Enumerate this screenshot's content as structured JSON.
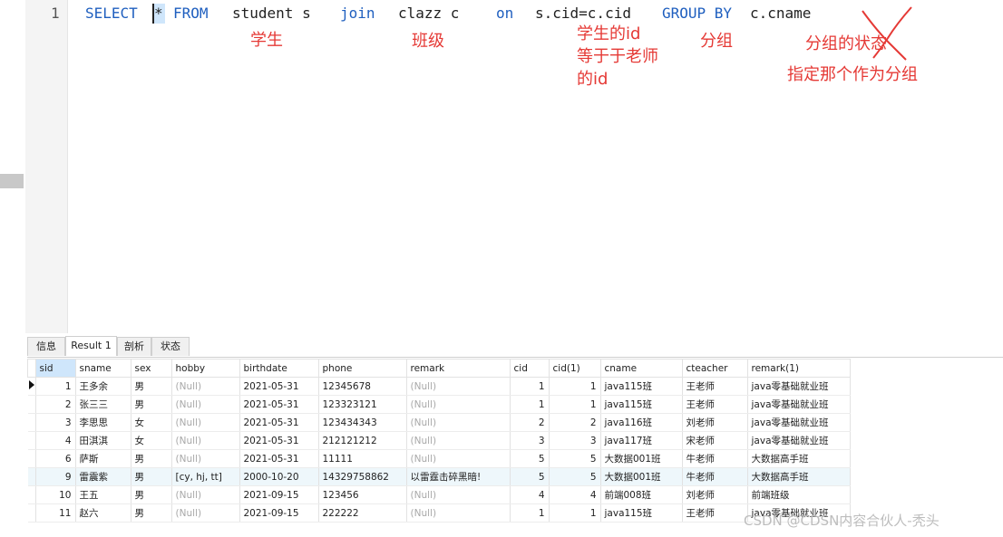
{
  "editor": {
    "line_number": "1",
    "tokens": [
      "SELECT",
      "*",
      "FROM",
      "student s",
      "join",
      "clazz c",
      "on",
      "s.cid=c.cid",
      "GROUP BY",
      "c.cname"
    ],
    "annotations": {
      "student": "学生",
      "clazz": "班级",
      "id_lines": [
        "学生的id",
        "等于于老师",
        "的id"
      ],
      "group": "分组",
      "state": "分组的状态",
      "specify": "指定那个作为分组"
    }
  },
  "tabs": [
    "信息",
    "Result 1",
    "剖析",
    "状态"
  ],
  "table": {
    "columns": [
      "sid",
      "sname",
      "sex",
      "hobby",
      "birthdate",
      "phone",
      "remark",
      "cid",
      "cid(1)",
      "cname",
      "cteacher",
      "remark(1)"
    ],
    "rows": [
      [
        "1",
        "王多余",
        "男",
        "(Null)",
        "2021-05-31",
        "12345678",
        "(Null)",
        "1",
        "1",
        "java115班",
        "王老师",
        "java零基础就业班"
      ],
      [
        "2",
        "张三三",
        "男",
        "(Null)",
        "2021-05-31",
        "123323121",
        "(Null)",
        "1",
        "1",
        "java115班",
        "王老师",
        "java零基础就业班"
      ],
      [
        "3",
        "李思思",
        "女",
        "(Null)",
        "2021-05-31",
        "123434343",
        "(Null)",
        "2",
        "2",
        "java116班",
        "刘老师",
        "java零基础就业班"
      ],
      [
        "4",
        "田淇淇",
        "女",
        "(Null)",
        "2021-05-31",
        "212121212",
        "(Null)",
        "3",
        "3",
        "java117班",
        "宋老师",
        "java零基础就业班"
      ],
      [
        "6",
        "萨斯",
        "男",
        "(Null)",
        "2021-05-31",
        "11111",
        "(Null)",
        "5",
        "5",
        "大数据001班",
        "牛老师",
        "大数据高手班"
      ],
      [
        "9",
        "雷震紫",
        "男",
        "[cy, hj, tt]",
        "2000-10-20",
        "14329758862",
        "以雷霆击碎黑暗!",
        "5",
        "5",
        "大数据001班",
        "牛老师",
        "大数据高手班"
      ],
      [
        "10",
        "王五",
        "男",
        "(Null)",
        "2021-09-15",
        "123456",
        "(Null)",
        "4",
        "4",
        "前端008班",
        "刘老师",
        "前端班级"
      ],
      [
        "11",
        "赵六",
        "男",
        "(Null)",
        "2021-09-15",
        "222222",
        "(Null)",
        "1",
        "1",
        "java115班",
        "王老师",
        "java零基础就业班"
      ]
    ]
  },
  "watermark": "CSDN @CDSN内容合伙人-秃头",
  "colors": {
    "annotation": "#e53935",
    "keyword": "#1f5fbf",
    "selected_header": "#cfe6fb",
    "highlight_row": "#eef7fb"
  }
}
